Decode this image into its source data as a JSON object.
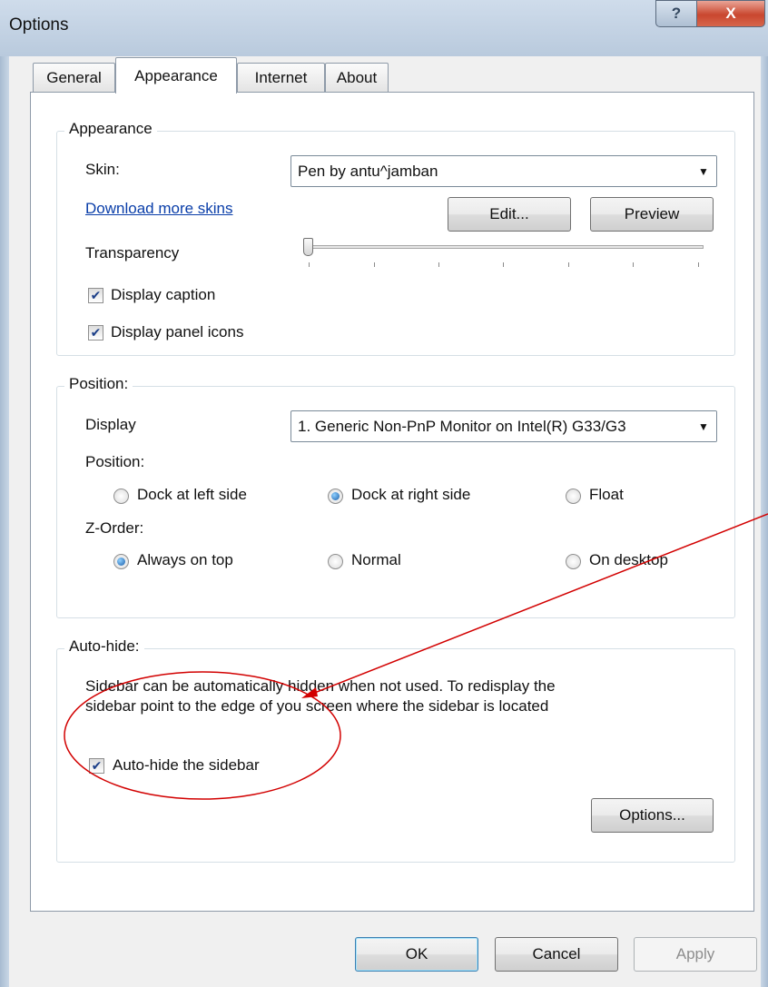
{
  "window": {
    "title": "Options",
    "help_glyph": "?",
    "close_glyph": "X"
  },
  "tabs": [
    {
      "label": "General",
      "active": false
    },
    {
      "label": "Appearance",
      "active": true
    },
    {
      "label": "Internet",
      "active": false
    },
    {
      "label": "About",
      "active": false
    }
  ],
  "appearance": {
    "group_title": "Appearance",
    "skin_label": "Skin:",
    "skin_value": "Pen by antu^jamban",
    "download_link": "Download more skins",
    "edit_button": "Edit...",
    "preview_button": "Preview",
    "transparency_label": "Transparency",
    "transparency_level": 0,
    "display_caption": {
      "label": "Display caption",
      "checked": true
    },
    "display_panel_icons": {
      "label": "Display panel icons",
      "checked": true
    }
  },
  "position": {
    "group_title": "Position:",
    "display_label": "Display",
    "display_value": "1. Generic Non-PnP Monitor on Intel(R) G33/G3",
    "position_label": "Position:",
    "position_options": [
      {
        "label": "Dock at left side",
        "selected": false
      },
      {
        "label": "Dock at right side",
        "selected": true
      },
      {
        "label": "Float",
        "selected": false
      }
    ],
    "zorder_label": "Z-Order:",
    "zorder_options": [
      {
        "label": "Always on top",
        "selected": true
      },
      {
        "label": "Normal",
        "selected": false
      },
      {
        "label": "On desktop",
        "selected": false
      }
    ]
  },
  "autohide": {
    "group_title": "Auto-hide:",
    "description_line1": "Sidebar can be automatically hidden when not used. To redisplay the",
    "description_line2": "sidebar point to the edge of you screen where the sidebar is located",
    "checkbox": {
      "label": "Auto-hide the sidebar",
      "checked": true
    },
    "options_button": "Options..."
  },
  "footer": {
    "ok_button": "OK",
    "cancel_button": "Cancel",
    "apply_button": "Apply"
  },
  "colors": {
    "annotation": "#d20000",
    "link": "#0a3ea9"
  },
  "icons": {
    "checkmark": "✔",
    "dropdown": "▼"
  }
}
